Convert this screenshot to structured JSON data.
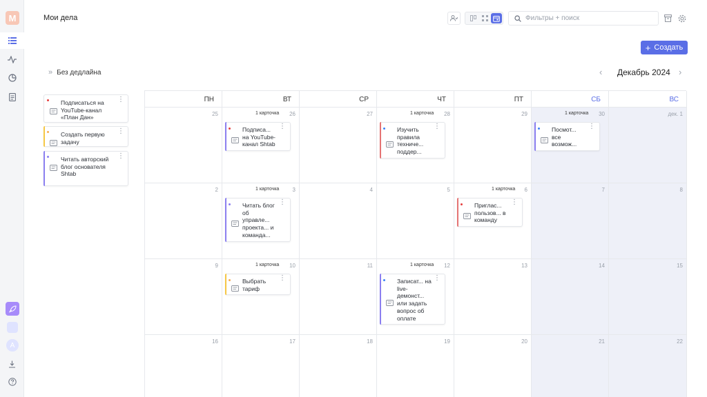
{
  "app": {
    "logo_letter": "M",
    "rocket": "rocket-icon"
  },
  "rail": {
    "items": [
      "list-icon",
      "activity-icon",
      "chart-pie-icon",
      "document-icon"
    ],
    "bottom": [
      "download-icon",
      "help-icon"
    ],
    "avatar_letter": "A"
  },
  "header": {
    "title": "Мои дела"
  },
  "search": {
    "placeholder": "Фильтры + поиск"
  },
  "toolbar": {
    "create_label": "Создать"
  },
  "no_deadline": {
    "label": "Без дедлайна"
  },
  "calendar": {
    "month_label": "Декабрь 2024",
    "weekdays": [
      "ПН",
      "ВТ",
      "СР",
      "ЧТ",
      "ПТ",
      "СБ",
      "ВС"
    ],
    "weeks": [
      [
        "25",
        "26",
        "27",
        "28",
        "29",
        "30",
        "дек. 1"
      ],
      [
        "2",
        "3",
        "4",
        "5",
        "6",
        "7",
        "8"
      ],
      [
        "9",
        "10",
        "11",
        "12",
        "13",
        "14",
        "15"
      ],
      [
        "16",
        "17",
        "18",
        "19",
        "20",
        "21",
        "22"
      ]
    ],
    "count_label": "1 карточка"
  },
  "colors": {
    "accent": "#5a6ee6",
    "red": "#e53e3e",
    "orange": "#f6ad55",
    "yellow": "#f6c744",
    "purple": "#8b7ff0",
    "blue": "#3b82f6"
  },
  "backlog": [
    {
      "text": "Подписаться на YouTube-канал «План Дан»",
      "dot": "#e53e3e",
      "bar": ""
    },
    {
      "text": "Создать первую задачу",
      "dot": "#f6ad55",
      "bar": "#f6c744"
    },
    {
      "text": "Читать авторский блог основателя Shtab",
      "dot": "#8b7ff0",
      "bar": "#8b7ff0"
    }
  ],
  "cards": [
    {
      "week": 0,
      "day": 1,
      "text": "Подписа... на YouTube-канал Shtab",
      "dot": "#e53e3e",
      "bar": "#8b7ff0"
    },
    {
      "week": 0,
      "day": 3,
      "text": "Изучить правила техниче... поддер...",
      "dot": "#3b82f6",
      "bar": "#e57373"
    },
    {
      "week": 0,
      "day": 5,
      "text": "Посмот... все возмож...",
      "dot": "#3b82f6",
      "bar": "#8b7ff0"
    },
    {
      "week": 1,
      "day": 1,
      "text": "Читать блог об управле... проекта... и команда...",
      "dot": "#8b7ff0",
      "bar": "#8b7ff0"
    },
    {
      "week": 1,
      "day": 4,
      "text": "Приглас... пользов... в команду",
      "dot": "#e53e3e",
      "bar": "#e57373"
    },
    {
      "week": 2,
      "day": 1,
      "text": "Выбрать тариф",
      "dot": "#f6ad55",
      "bar": "#f6c744"
    },
    {
      "week": 2,
      "day": 3,
      "text": "Записат... на live-демонст... или задать вопрос об оплате",
      "dot": "#3b82f6",
      "bar": "#8b7ff0"
    }
  ]
}
